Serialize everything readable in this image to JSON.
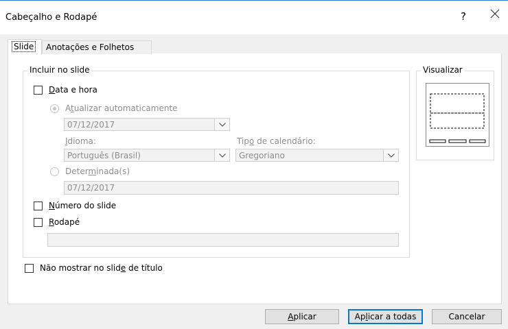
{
  "window": {
    "title": "Cabeçalho e Rodapé",
    "help_glyph": "?"
  },
  "tabs": [
    {
      "label": "Slide",
      "selected": true
    },
    {
      "label": "Anotações e Folhetos",
      "selected": false
    }
  ],
  "include_group": {
    "legend": "Incluir no slide",
    "date_time": {
      "pre": "",
      "key": "D",
      "post": "ata e hora",
      "checked": false
    },
    "auto_update": {
      "pre": "A",
      "key": "t",
      "post": "ualizar automaticamente",
      "selected": true,
      "enabled": false
    },
    "auto_date_value": "07/12/2017",
    "language": {
      "label_key": "I",
      "label_post": "dioma:",
      "value": "Português (Brasil)"
    },
    "calendar": {
      "label_pre": "Tip",
      "label_key": "o",
      "label_post": " de calendário:",
      "value": "Gregoriano"
    },
    "fixed": {
      "pre": "Deter",
      "key": "m",
      "post": "inada(s)",
      "selected": false,
      "enabled": false
    },
    "fixed_value": "07/12/2017",
    "slide_number": {
      "pre": "",
      "key": "N",
      "post": "úmero do slide",
      "checked": false
    },
    "footer": {
      "pre": "",
      "key": "R",
      "post": "odapé",
      "checked": false
    },
    "footer_value": ""
  },
  "dont_show_title": {
    "pre": "Não mostrar no slid",
    "key": "e",
    "post": " de título",
    "checked": false
  },
  "preview": {
    "legend": "Visualizar"
  },
  "buttons": {
    "apply": {
      "pre": "",
      "key": "A",
      "post": "plicar"
    },
    "apply_all": {
      "pre": "Ap",
      "key": "l",
      "post": "icar a todas"
    },
    "cancel": "Cancelar"
  },
  "colors": {
    "accent": "#0078d7",
    "window_border": "#2b7bd1",
    "disabled_text": "#8d8d8d"
  }
}
